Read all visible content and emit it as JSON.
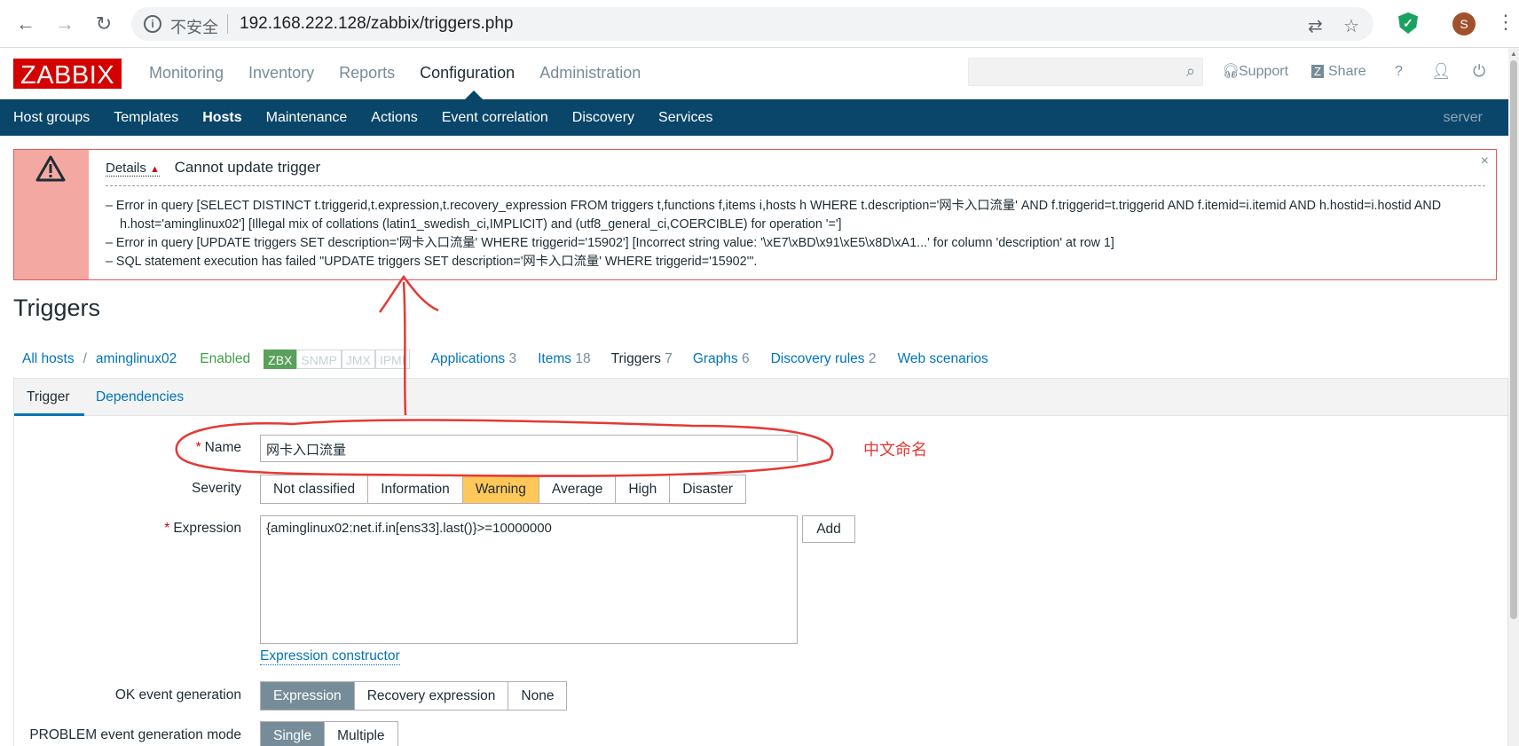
{
  "browser": {
    "insecure_label": "不安全",
    "url": "192.168.222.128/zabbix/triggers.php",
    "avatar_letter": "S"
  },
  "header": {
    "logo": "ZABBIX",
    "menu": [
      "Monitoring",
      "Inventory",
      "Reports",
      "Configuration",
      "Administration"
    ],
    "support": "Support",
    "share": "Share",
    "help": "?"
  },
  "subnav": {
    "items": [
      "Host groups",
      "Templates",
      "Hosts",
      "Maintenance",
      "Actions",
      "Event correlation",
      "Discovery",
      "Services"
    ],
    "server": "server"
  },
  "error": {
    "details": "Details",
    "title": "Cannot update trigger",
    "messages": [
      "– Error in query [SELECT DISTINCT t.triggerid,t.expression,t.recovery_expression FROM triggers t,functions f,items i,hosts h WHERE t.description='网卡入口流量' AND f.triggerid=t.triggerid AND f.itemid=i.itemid AND h.hostid=i.hostid AND h.host='aminglinux02'] [Illegal mix of collations (latin1_swedish_ci,IMPLICIT) and (utf8_general_ci,COERCIBLE) for operation '=']",
      "– Error in query [UPDATE triggers SET description='网卡入口流量' WHERE triggerid='15902'] [Incorrect string value: '\\xE7\\xBD\\x91\\xE5\\x8D\\xA1...' for column 'description' at row 1]",
      "– SQL statement execution has failed \"UPDATE triggers SET description='网卡入口流量' WHERE triggerid='15902'\"."
    ]
  },
  "page_title": "Triggers",
  "hostnav": {
    "all_hosts": "All hosts",
    "sep": "/",
    "host": "aminglinux02",
    "status": "Enabled",
    "badges": [
      "ZBX",
      "SNMP",
      "JMX",
      "IPMI"
    ],
    "applications": "Applications",
    "applications_count": "3",
    "items": "Items",
    "items_count": "18",
    "triggers": "Triggers",
    "triggers_count": "7",
    "graphs": "Graphs",
    "graphs_count": "6",
    "discovery": "Discovery rules",
    "discovery_count": "2",
    "web": "Web scenarios"
  },
  "form": {
    "tabs": [
      "Trigger",
      "Dependencies"
    ],
    "name_label": "Name",
    "name_value": "网卡入口流量",
    "severity_label": "Severity",
    "severity_options": [
      "Not classified",
      "Information",
      "Warning",
      "Average",
      "High",
      "Disaster"
    ],
    "severity_selected": "Warning",
    "expression_label": "Expression",
    "expression_value": "{aminglinux02:net.if.in[ens33].last()}>=10000000",
    "add_button": "Add",
    "expression_constructor": "Expression constructor",
    "ok_event_label": "OK event generation",
    "ok_event_options": [
      "Expression",
      "Recovery expression",
      "None"
    ],
    "ok_event_selected": "Expression",
    "problem_mode_label": "PROBLEM event generation mode",
    "problem_mode_options": [
      "Single",
      "Multiple"
    ],
    "problem_mode_selected": "Single"
  },
  "annotation": "中文命名",
  "colors": {
    "nav_blue": "#0a466a",
    "logo_red": "#d40000",
    "warning": "#ffc859",
    "link": "#0275b8",
    "annotation_red": "#e53935"
  }
}
